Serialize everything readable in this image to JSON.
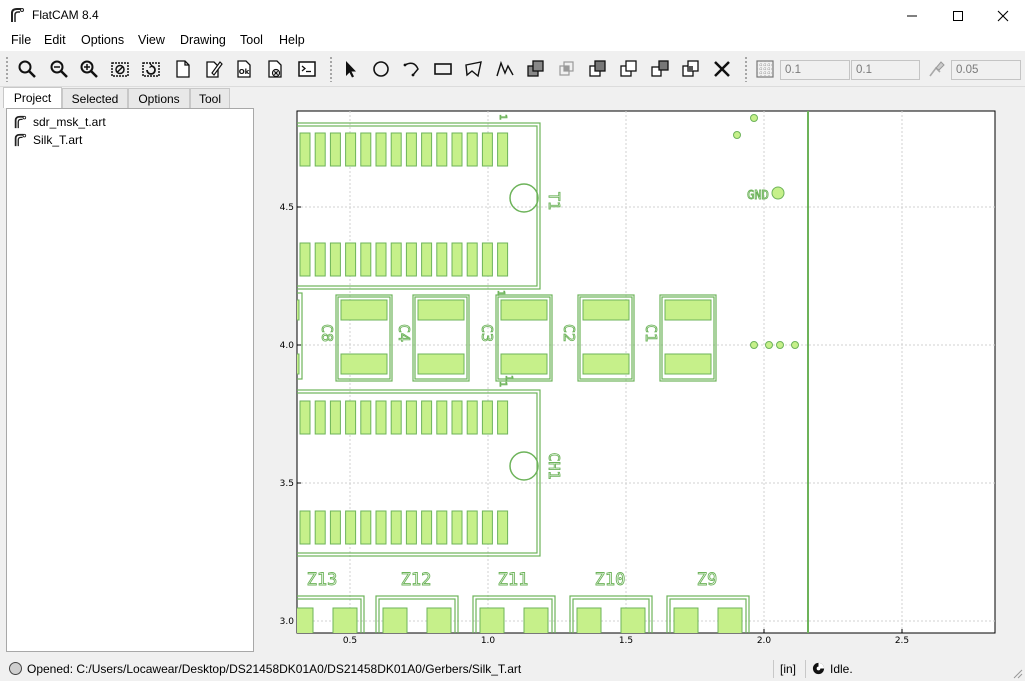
{
  "window": {
    "title": "FlatCAM 8.4"
  },
  "menu": [
    "File",
    "Edit",
    "Options",
    "View",
    "Drawing",
    "Tool",
    "Help"
  ],
  "toolbar": {
    "grid_x": "0.1",
    "grid_y": "0.1",
    "snap_max": "0.05"
  },
  "tabs": [
    "Project",
    "Selected",
    "Options",
    "Tool"
  ],
  "active_tab": "Project",
  "project": {
    "items": [
      "sdr_msk_t.art",
      "Silk_T.art"
    ]
  },
  "plot": {
    "x_ticks": [
      "0.5",
      "1.0",
      "1.5",
      "2.0",
      "2.5"
    ],
    "y_ticks": [
      "4.5",
      "4.0",
      "3.5",
      "3.0"
    ],
    "colors": {
      "outline": "#6db35a",
      "fill": "#c6f08a",
      "background": "#ffffff",
      "grid": "#d0d0d0"
    },
    "labels": {
      "t1": "T1",
      "ch1": "CH1",
      "gnd": "GND",
      "caps": [
        "C8",
        "C4",
        "C3",
        "C2",
        "C1"
      ],
      "zeners": [
        "Z13",
        "Z12",
        "Z11",
        "Z10",
        "Z9"
      ],
      "one": "1"
    }
  },
  "status": {
    "message": "Opened: C:/Users/Locawear/Desktop/DS21458DK01A0/DS21458DK01A0/Gerbers/Silk_T.art",
    "units": "[in]",
    "state": "Idle."
  }
}
